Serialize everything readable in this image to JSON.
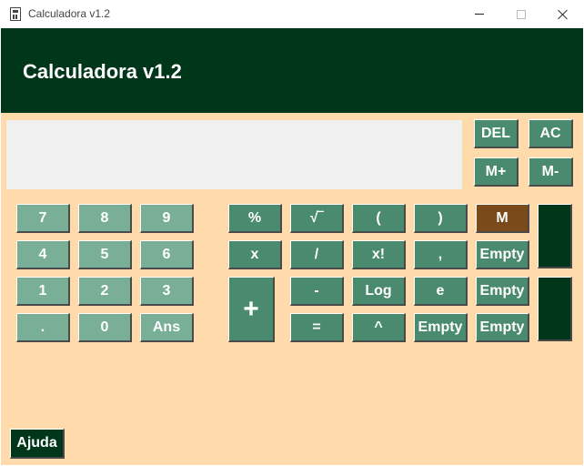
{
  "window": {
    "title": "Calculadora v1.2",
    "icon": "calculator-icon"
  },
  "header": {
    "title": "Calculadora v1.2"
  },
  "display": {
    "value": ""
  },
  "controls": {
    "del": "DEL",
    "ac": "AC",
    "mplus": "M+",
    "mminus": "M-"
  },
  "numpad": {
    "k7": "7",
    "k8": "8",
    "k9": "9",
    "k4": "4",
    "k5": "5",
    "k6": "6",
    "k1": "1",
    "k2": "2",
    "k3": "3",
    "dot": ".",
    "k0": "0",
    "ans": "Ans"
  },
  "operators": {
    "percent": "%",
    "sqrt": "√‾",
    "lparen": "(",
    "rparen": ")",
    "mult": "x",
    "div": "/",
    "fact": "x!",
    "comma": ",",
    "plus": "+",
    "minus": "-",
    "log": "Log",
    "e": "e",
    "equals": "=",
    "power": "^",
    "empty_op": "Empty"
  },
  "memory": {
    "m": "M",
    "slot1": "Empty",
    "slot2": "Empty",
    "slot3": "Empty"
  },
  "help": {
    "label": "Ajuda"
  },
  "colors": {
    "header_bg": "#00361a",
    "body_bg": "#ffdaaa",
    "num_button": "#79ae97",
    "op_button": "#4a8a6e",
    "memory_button": "#7a4a1a",
    "display_bg": "#f0f0f0"
  }
}
